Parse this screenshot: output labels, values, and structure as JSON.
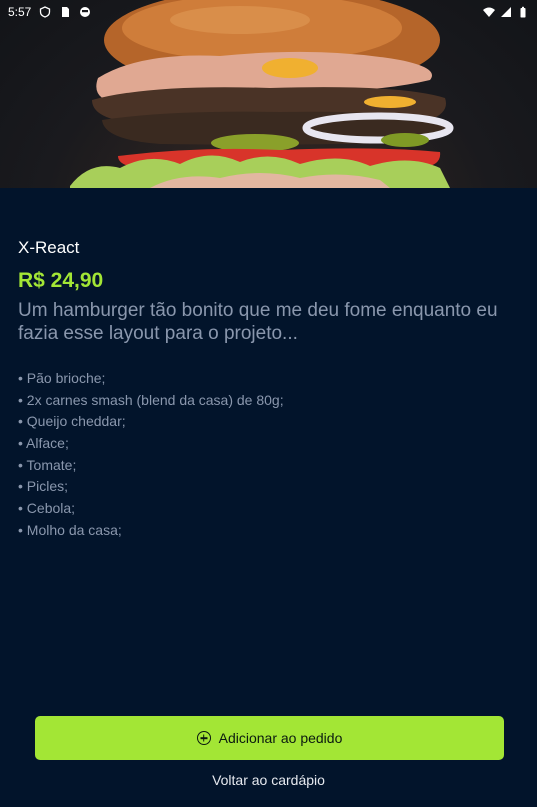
{
  "statusbar": {
    "time": "5:57",
    "left_icons": [
      "shield-icon",
      "sim-card-icon",
      "circle-status-icon"
    ],
    "right_icons": [
      "wifi-icon",
      "signal-icon",
      "battery-icon"
    ]
  },
  "hero": {
    "image": "burger-photo"
  },
  "product": {
    "name": "X-React",
    "price": "R$ 24,90",
    "description": "Um hamburger tão bonito que me deu fome enquanto eu fazia esse layout para o projeto...",
    "ingredients": [
      "Pão brioche;",
      "2x carnes smash (blend da casa) de 80g;",
      "Queijo cheddar;",
      "Alface;",
      "Tomate;",
      "Picles;",
      "Cebola;",
      "Molho da casa;"
    ]
  },
  "actions": {
    "add_label": "Adicionar ao pedido",
    "back_label": "Voltar ao cardápio"
  },
  "colors": {
    "background": "#02142b",
    "accent": "#a3e635",
    "muted_text": "#8a97ad"
  }
}
